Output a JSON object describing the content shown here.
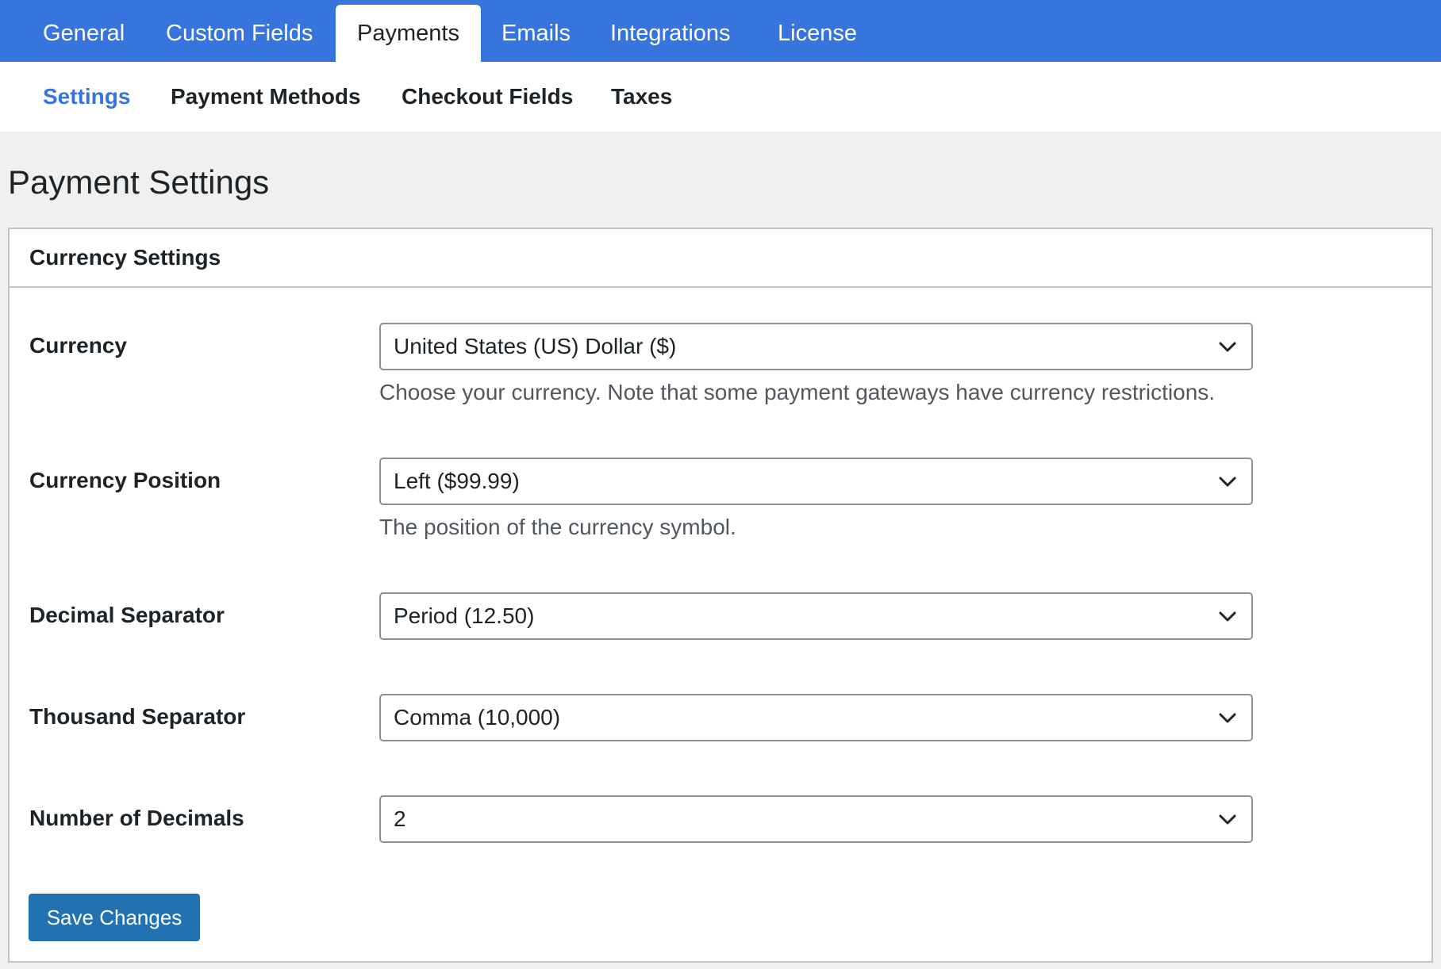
{
  "top_tabs": [
    {
      "label": "General"
    },
    {
      "label": "Custom Fields"
    },
    {
      "label": "Payments"
    },
    {
      "label": "Emails"
    },
    {
      "label": "Integrations"
    },
    {
      "label": "License"
    }
  ],
  "active_top_tab": "Payments",
  "sub_tabs": [
    {
      "label": "Settings"
    },
    {
      "label": "Payment Methods"
    },
    {
      "label": "Checkout Fields"
    },
    {
      "label": "Taxes"
    }
  ],
  "active_sub_tab": "Settings",
  "page_title": "Payment Settings",
  "panel": {
    "title": "Currency Settings",
    "fields": [
      {
        "label": "Currency",
        "value": "United States (US) Dollar ($)",
        "help": "Choose your currency. Note that some payment gateways have currency restrictions."
      },
      {
        "label": "Currency Position",
        "value": "Left ($99.99)",
        "help": "The position of the currency symbol."
      },
      {
        "label": "Decimal Separator",
        "value": "Period (12.50)"
      },
      {
        "label": "Thousand Separator",
        "value": "Comma (10,000)"
      },
      {
        "label": "Number of Decimals",
        "value": "2"
      }
    ],
    "save_label": "Save Changes"
  },
  "icons": {
    "select_arrow": "chevron-down-icon"
  },
  "colors": {
    "accent": "#3874dd",
    "button": "#2271b1",
    "border": "#c3c4c7"
  }
}
